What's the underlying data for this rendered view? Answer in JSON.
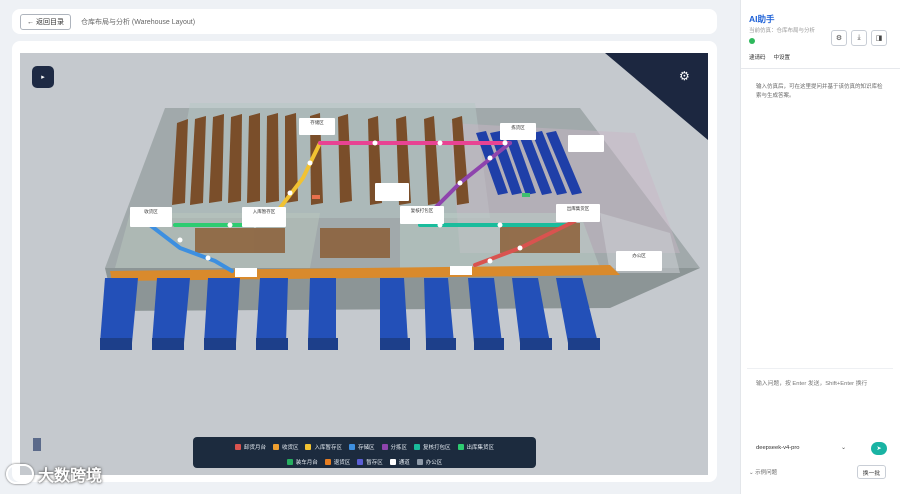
{
  "topbar": {
    "back_label": "← 返回目录",
    "breadcrumb": "仓库布局与分析 (Warehouse Layout)"
  },
  "viewport": {
    "zone_labels": [
      {
        "id": "receiving",
        "title": "收货区",
        "sub": ""
      },
      {
        "id": "inbound_staging",
        "title": "入库暂存区",
        "sub": ""
      },
      {
        "id": "storage",
        "title": "存储区",
        "sub": ""
      },
      {
        "id": "picking",
        "title": "拣货区",
        "sub": ""
      },
      {
        "id": "packing",
        "title": "复核打包区",
        "sub": ""
      },
      {
        "id": "outbound_staging",
        "title": "出库集货区",
        "sub": ""
      },
      {
        "id": "office",
        "title": "办公区",
        "sub": ""
      },
      {
        "id": "small",
        "title": "",
        "sub": ""
      }
    ],
    "legend": {
      "row1": [
        {
          "label": "卸货月台",
          "color": "#d9534f"
        },
        {
          "label": "收货区",
          "color": "#f0a030"
        },
        {
          "label": "入库暂存区",
          "color": "#f1c232"
        },
        {
          "label": "存储区",
          "color": "#3d8fe0"
        },
        {
          "label": "分拣区",
          "color": "#8e44ad"
        },
        {
          "label": "复核打包区",
          "color": "#1abc9c"
        },
        {
          "label": "出库集货区",
          "color": "#2ecc71"
        }
      ],
      "row2": [
        {
          "label": "装车月台",
          "color": "#27ae60"
        },
        {
          "label": "退货区",
          "color": "#e67e22"
        },
        {
          "label": "暂存区",
          "color": "#5b5fd6"
        },
        {
          "label": "通道",
          "color": "#ffffff"
        },
        {
          "label": "办公区",
          "color": "#8e9aa8"
        }
      ]
    }
  },
  "watermark": {
    "text": "大数跨境"
  },
  "ai": {
    "title": "AI助手",
    "subtitle": "当前仿真：仓库布局与分析",
    "links": [
      "逮请码",
      "中设置"
    ],
    "intro": "输入仿真后，可在这里提问并基于该仿真的知识库检索与生成答案。",
    "input_placeholder": "输入问题，按 Enter 发送，Shift+Enter 换行",
    "model": "deepseek-v4-pro",
    "examples_label": "示例问题",
    "refresh_label": "换一批"
  }
}
